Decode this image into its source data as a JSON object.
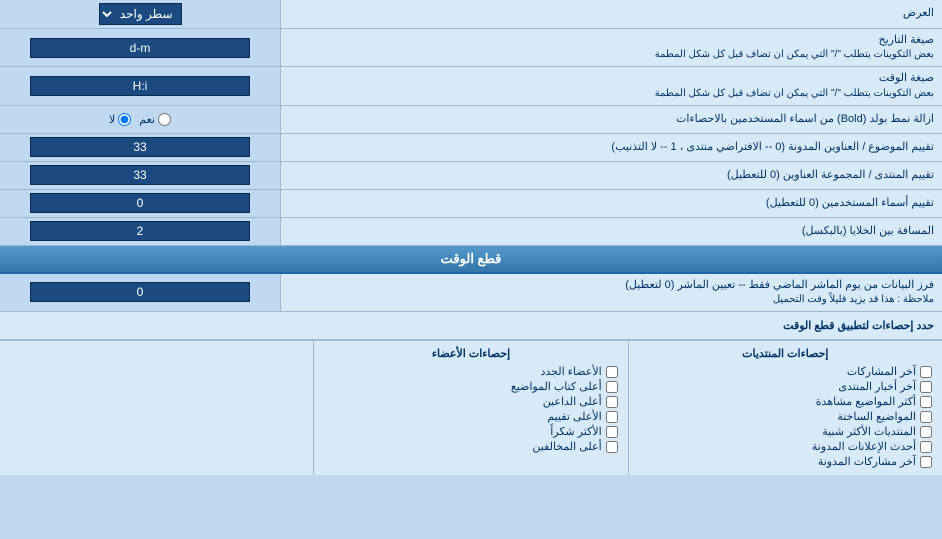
{
  "page": {
    "title": "العرض",
    "singleLine_label": "سطر واحد",
    "dateFormat": {
      "label": "صيغة التاريخ",
      "note": "بعض التكوينات يتطلب \"/\" التي يمكن ان تضاف قبل كل شكل المطمة",
      "value": "d-m"
    },
    "timeFormat": {
      "label": "صيغة الوقت",
      "note": "بعض التكوينات يتطلب \"/\" التي يمكن ان تضاف قبل كل شكل المطمة",
      "value": "H:i"
    },
    "boldRemove": {
      "label": "ازالة نمط بولد (Bold) من اسماء المستخدمين بالاحصاءات",
      "option_yes": "نعم",
      "option_no": "لا",
      "selected": "no"
    },
    "subjectSort": {
      "label": "تقييم الموضوع / العناوين المدونة (0 -- الافتراضي منتدى ، 1 -- لا التذنيب)",
      "value": "33"
    },
    "forumSort": {
      "label": "تقييم المنتدى / المجموعة العناوين (0 للتعطيل)",
      "value": "33"
    },
    "userSort": {
      "label": "تقييم أسماء المستخدمين (0 للتعطيل)",
      "value": "0"
    },
    "cellSpacing": {
      "label": "المسافة بين الخلايا (بالبكسل)",
      "value": "2"
    },
    "timecut": {
      "sectionHeader": "قطع الوقت",
      "filterLabel": "فرز البيانات من يوم الماشر الماضي فقط -- تعيين الماشر (0 لتعطيل)",
      "note": "ملاحظة : هذا قد يزيد قليلاً وقت التحميل",
      "value": "0"
    },
    "statsLimit": {
      "label": "حدد إحصاءات لتطبيق قطع الوقت"
    },
    "statsColumns": {
      "col1_header": "إحصاءات المنتديات",
      "col2_header": "إحصاءات الأعضاء",
      "col1_items": [
        "آخر المشاركات",
        "آخر أخبار المنتدى",
        "أكثر المواضيع مشاهدة",
        "المواضيع الساخنة",
        "المنتديات الأكثر شبية",
        "أحدث الإعلانات المدونة",
        "آخر مشاركات المدونة"
      ],
      "col2_items": [
        "الأعضاء الجدد",
        "أعلى كتاب المواضيع",
        "أعلى الداعين",
        "الأعلى تقييم",
        "الأكثر شكراً",
        "أعلى المخالفين"
      ]
    }
  }
}
